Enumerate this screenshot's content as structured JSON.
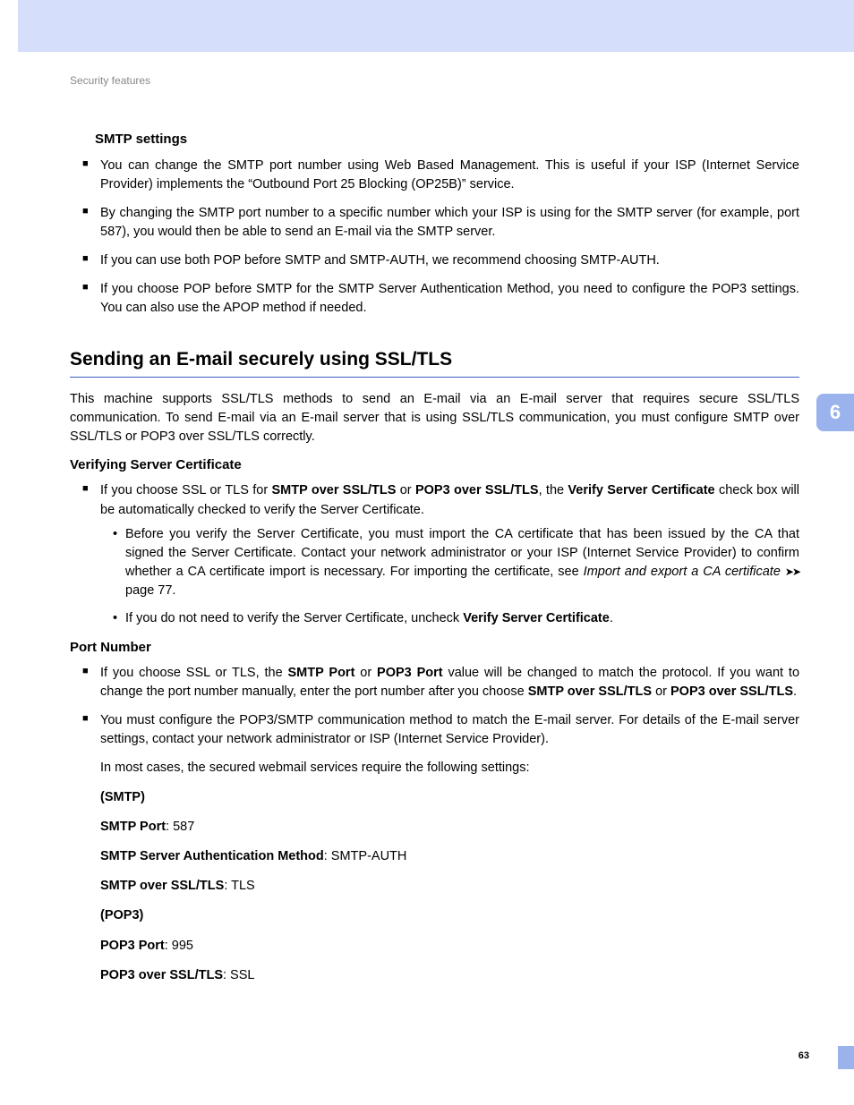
{
  "header": "Security features",
  "page_number": "63",
  "chapter_tab": "6",
  "smtp_settings": {
    "heading": "SMTP settings",
    "bullets": [
      "You can change the SMTP port number using Web Based Management. This is useful if your ISP (Internet Service Provider) implements the “Outbound Port 25 Blocking (OP25B)” service.",
      "By changing the SMTP port number to a specific number which your ISP is using for the SMTP server (for example, port 587), you would then be able to send an E-mail via the SMTP server.",
      "If you can use both POP before SMTP and SMTP-AUTH, we recommend choosing SMTP-AUTH.",
      "If you choose POP before SMTP for the SMTP Server Authentication Method, you need to configure the POP3 settings. You can also use the APOP method if needed."
    ]
  },
  "ssl_section": {
    "heading": "Sending an E-mail securely using SSL/TLS",
    "intro": "This machine supports SSL/TLS methods to send an E-mail via an E-mail server that requires secure SSL/TLS communication. To send E-mail via an E-mail server that is using SSL/TLS communication, you must configure SMTP over SSL/TLS or POP3 over SSL/TLS correctly.",
    "verify_heading": "Verifying Server Certificate",
    "verify_bullet": {
      "pre": "If you choose SSL or TLS for ",
      "b1": "SMTP over SSL/TLS",
      "mid1": " or ",
      "b2": "POP3 over SSL/TLS",
      "mid2": ", the ",
      "b3": "Verify Server Certificate",
      "post": " check box will be automatically checked to verify the Server Certificate."
    },
    "verify_sub1": {
      "text": "Before you verify the Server Certificate, you must import the CA certificate that has been issued by the CA that signed the Server Certificate. Contact your network administrator or your ISP (Internet Service Provider) to confirm whether a CA certificate import is necessary. For importing the certificate, see ",
      "ref_italic": "Import and export a CA certificate",
      "ref_tail": " page 77."
    },
    "verify_sub2": {
      "pre": "If you do not need to verify the Server Certificate, uncheck ",
      "b1": "Verify Server Certificate",
      "post": "."
    },
    "port_heading": "Port Number",
    "port_bullet1": {
      "pre": "If you choose SSL or TLS, the ",
      "b1": "SMTP Port",
      "mid1": " or ",
      "b2": "POP3 Port",
      "mid2": " value will be changed to match the protocol. If you want to change the port number manually, enter the port number after you choose ",
      "b3": "SMTP over SSL/TLS",
      "mid3": " or ",
      "b4": "POP3 over SSL/TLS",
      "post": "."
    },
    "port_bullet2": "You must configure the POP3/SMTP communication method to match the E-mail server. For details of the E-mail server settings, contact your network administrator or ISP (Internet Service Provider).",
    "port_note": "In most cases, the secured webmail services require the following settings:",
    "settings": {
      "smtp_label": "(SMTP)",
      "smtp_port_label": "SMTP Port",
      "smtp_port_value": ": 587",
      "smtp_auth_label": "SMTP Server Authentication Method",
      "smtp_auth_value": ": SMTP-AUTH",
      "smtp_ssl_label": "SMTP over SSL/TLS",
      "smtp_ssl_value": ": TLS",
      "pop3_label": "(POP3)",
      "pop3_port_label": "POP3 Port",
      "pop3_port_value": ": 995",
      "pop3_ssl_label": "POP3 over SSL/TLS",
      "pop3_ssl_value": ": SSL"
    }
  }
}
